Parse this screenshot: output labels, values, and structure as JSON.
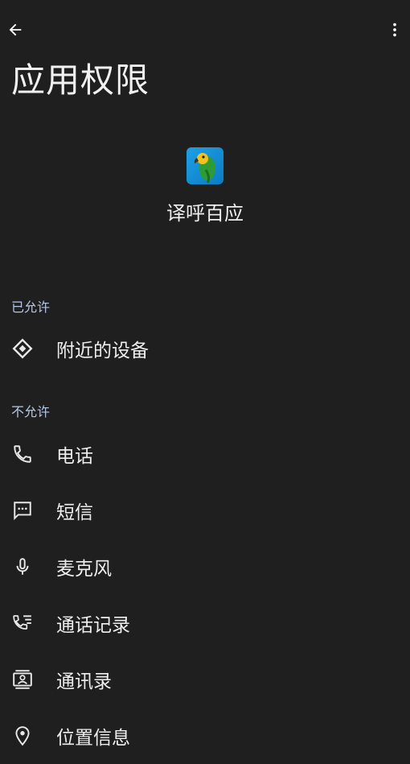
{
  "header": {
    "title": "应用权限"
  },
  "app": {
    "name": "译呼百应"
  },
  "sections": {
    "allowed": {
      "label": "已允许",
      "items": [
        {
          "label": "附近的设备",
          "icon": "nearby-devices-icon"
        }
      ]
    },
    "denied": {
      "label": "不允许",
      "items": [
        {
          "label": "电话",
          "icon": "phone-icon"
        },
        {
          "label": "短信",
          "icon": "sms-icon"
        },
        {
          "label": "麦克风",
          "icon": "microphone-icon"
        },
        {
          "label": "通话记录",
          "icon": "call-log-icon"
        },
        {
          "label": "通讯录",
          "icon": "contacts-icon"
        },
        {
          "label": "位置信息",
          "icon": "location-icon"
        }
      ]
    }
  },
  "colors": {
    "background": "#1f1f1f",
    "text": "#eeeeee",
    "section_label": "#b7c6e6"
  }
}
